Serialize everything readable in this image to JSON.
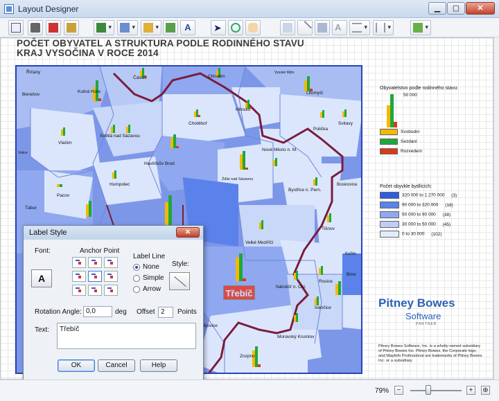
{
  "window": {
    "title": "Layout Designer"
  },
  "map": {
    "title_line1": "POČET OBYVATEL A STRUKTURA PODLE RODINNÉHO STAVU",
    "title_line2": "KRAJ VYSOČINA V ROCE 2014",
    "selected_label": "Třebíč",
    "towns": [
      "Říčany",
      "Benešov",
      "Kutná Hora",
      "Čáslav",
      "Chrudim",
      "Vysoké Mýto",
      "Litomyšl",
      "Hlinsko",
      "Chotěboř",
      "Svitavy",
      "Polička",
      "Světlá nad Sázavou",
      "Vlašim",
      "Votice",
      "Havlíčkův Brod",
      "Nové Město n. M.",
      "Humpolec",
      "Žďár nad Sázavou",
      "Boskovice",
      "Pacov",
      "Bystřice n. Pern.",
      "Tábor",
      "Tišnov",
      "Velké Meziříčí",
      "Kuřim",
      "Brno",
      "Rosice",
      "Náměšť n. Osl.",
      "Ivančice",
      "Moravský Krumlov",
      "Znojmo",
      "Budějovice"
    ]
  },
  "legend": {
    "title": "Obyvatelstvo podle rodinného stavu:",
    "scale_value": "50 000",
    "series": [
      {
        "name": "Svobodní",
        "color": "#f5b800"
      },
      {
        "name": "Sezdaní",
        "color": "#1fa83a"
      },
      {
        "name": "Rozvedení",
        "color": "#d93a1a"
      }
    ],
    "ranges_title": "Počet obyvkle bydlících:",
    "ranges": [
      {
        "label": "320 000  to  1 270 000",
        "count": "(3)",
        "color": "#2e5de0"
      },
      {
        "label": "90 000  to    320 000",
        "count": "(18)",
        "color": "#5a82ea"
      },
      {
        "label": "50 000  to      90 000",
        "count": "(38)",
        "color": "#8fa8f0"
      },
      {
        "label": "30 000  to      50 000",
        "count": "(45)",
        "color": "#bccdf6"
      },
      {
        "label": "0  to      30 000",
        "count": "(102)",
        "color": "#e2ecfc"
      }
    ]
  },
  "branding": {
    "logo": "Pitney Bowes",
    "software": "Software",
    "partner": "PARTNER",
    "copyright": "Pitney Bowes Software, Inc. is a wholly-owned subsidiary of Pitney Bowes Inc. Pitney Bowes, the Corporate logo, and MapInfo Professional are trademarks of Pitney Bowes Inc. or a subsidiary."
  },
  "dialog": {
    "title": "Label Style",
    "font_label": "Font:",
    "font_button": "A",
    "anchor_label": "Anchor Point",
    "label_line": "Label Line",
    "style_label": "Style:",
    "options": [
      "None",
      "Simple",
      "Arrow"
    ],
    "selected_option": "None",
    "rotation_label": "Rotation Angle:",
    "rotation_value": "0,0",
    "deg": "deg",
    "offset_label": "Offset",
    "offset_value": "2",
    "points": "Points",
    "text_label": "Text:",
    "text_value": "Třebíč",
    "ok": "OK",
    "cancel": "Cancel",
    "help": "Help"
  },
  "status": {
    "zoom": "79%"
  },
  "icons": [
    "new-layout-icon",
    "print-icon",
    "pdf-icon",
    "export-icon",
    "add-map-icon",
    "add-table-icon",
    "add-legend-icon",
    "add-image-icon",
    "add-text-icon",
    "select-icon",
    "zoom-icon",
    "pan-icon",
    "bring-front-icon",
    "line-icon",
    "shape-icon",
    "text-style-icon",
    "align-icon",
    "distribute-icon",
    "grid-icon"
  ]
}
